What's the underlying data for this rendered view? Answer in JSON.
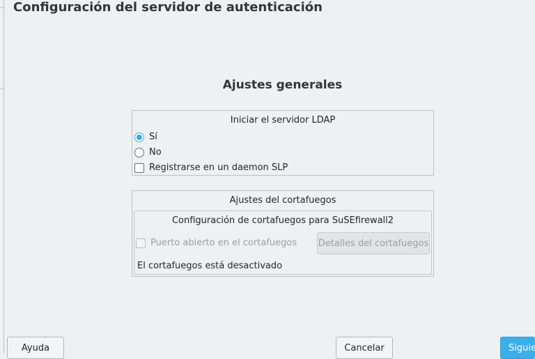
{
  "window": {
    "title": "Configuración del servidor de autenticación"
  },
  "main": {
    "heading": "Ajustes generales"
  },
  "ldap_group": {
    "title": "Iniciar el servidor LDAP",
    "option_yes": "Sí",
    "option_no": "No",
    "selected": "Sí",
    "slp_label": "Registrarse en un daemon SLP",
    "slp_checked": false
  },
  "firewall_group": {
    "title": "Ajustes del cortafuegos",
    "inner_title": "Configuración de cortafuegos para SuSEfirewall2",
    "open_port_label": "Puerto abierto en el cortafuegos",
    "open_port_checked": false,
    "details_button": "Detalles del cortafuegos",
    "status_text": "El cortafuegos está desactivado"
  },
  "buttons": {
    "help": "Ayuda",
    "cancel": "Cancelar",
    "next": "Siguie"
  },
  "colors": {
    "accent": "#3daee9",
    "background": "#eff0f1"
  }
}
